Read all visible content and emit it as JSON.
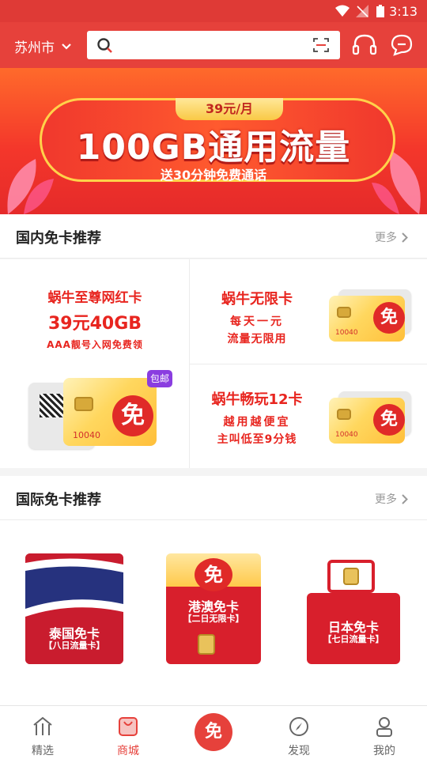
{
  "status_bar": {
    "time": "3:13"
  },
  "header": {
    "city": "苏州市",
    "search_placeholder": ""
  },
  "banner": {
    "price_tag": "39元/月",
    "headline": "100GB通用流量",
    "subline": "送30分钟免费通话"
  },
  "domestic": {
    "title": "国内免卡推荐",
    "more": "更多",
    "main_card": {
      "line1": "蜗牛至尊网红卡",
      "line2": "39元40GB",
      "line3": "AAA靓号入网免费领",
      "badge": "包邮",
      "sim_number": "10040",
      "sim_logo": "免"
    },
    "cards": [
      {
        "line1": "蜗牛无限卡",
        "line2": "每天一元",
        "line3": "流量无限用",
        "sim_number": "10040",
        "sim_logo": "免"
      },
      {
        "line1": "蜗牛畅玩12卡",
        "line2": "越用越便宜",
        "line3": "主叫低至9分钱",
        "sim_number": "10040",
        "sim_logo": "免"
      }
    ]
  },
  "international": {
    "title": "国际免卡推荐",
    "more": "更多",
    "cards": [
      {
        "name": "泰国免卡",
        "sub": "【八日流量卡】"
      },
      {
        "name": "港澳免卡",
        "sub": "【二日无限卡】",
        "logo": "免"
      },
      {
        "name": "日本免卡",
        "sub": "【七日流量卡】"
      }
    ]
  },
  "tabbar": {
    "items": [
      {
        "label": "精选"
      },
      {
        "label": "商城"
      },
      {
        "label": "免"
      },
      {
        "label": "发现"
      },
      {
        "label": "我的"
      }
    ],
    "active_index": 1
  },
  "colors": {
    "brand_red": "#e6413b",
    "banner_gold": "#ffd24a"
  }
}
